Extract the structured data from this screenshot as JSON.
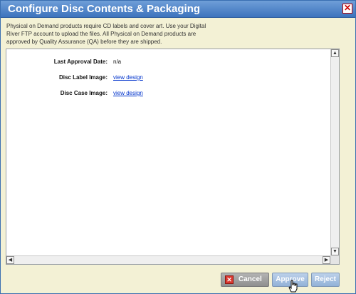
{
  "dialog": {
    "title": "Configure Disc Contents & Packaging",
    "close_glyph": "✕",
    "intro": "Physical on Demand products require CD labels and cover art. Use your Digital River FTP account to upload the files. All Physical on Demand products are approved by Quality Assurance (QA) before they are shipped."
  },
  "fields": [
    {
      "label": "Last Approval Date:",
      "value": "n/a"
    },
    {
      "label": "Disc Label Image:",
      "value": "view design"
    },
    {
      "label": "Disc Case Image:",
      "value": "view design"
    }
  ],
  "buttons": {
    "cancel": "Cancel",
    "approve": "Approve",
    "reject": "Reject"
  },
  "icons": {
    "close": "close-icon",
    "cancel": "x-icon",
    "cursor": "hand-pointer-icon"
  },
  "colors": {
    "titlebar": "#3d73bd",
    "background": "#f3f1d5",
    "link": "#0033cc"
  }
}
